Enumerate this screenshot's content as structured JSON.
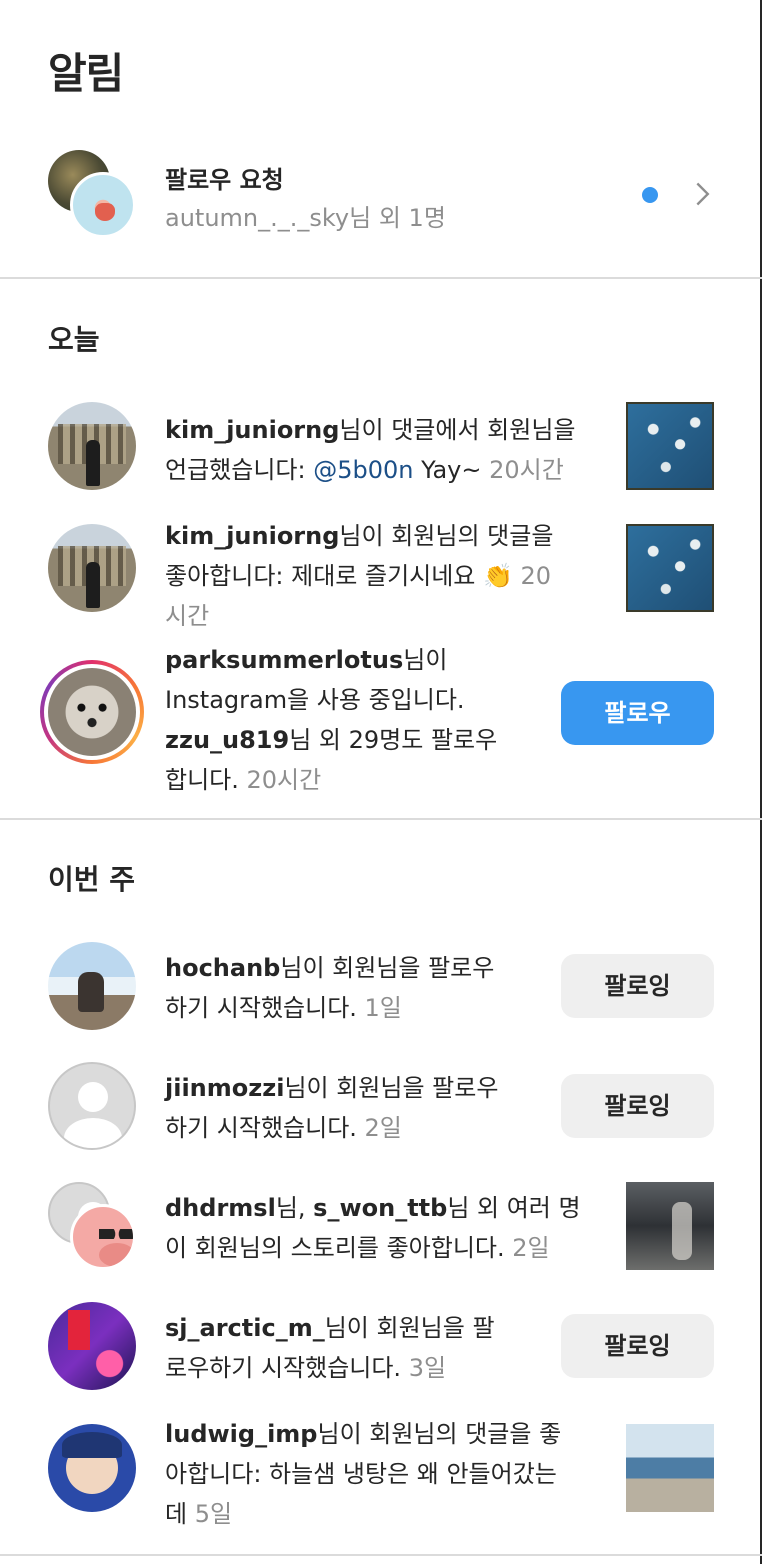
{
  "page": {
    "title": "알림"
  },
  "follow_request": {
    "title": "팔로우 요청",
    "subtitle": "autumn_._._sky님 외 1명"
  },
  "sections": {
    "today": "오늘",
    "this_week": "이번 주"
  },
  "today": [
    {
      "user": "kim_juniorng",
      "text_a": "님이 댓글에서 회원님을",
      "text_b": "언급했습니다: ",
      "mention": "@5b00n",
      "text_c": " Yay~ ",
      "time": "20시간"
    },
    {
      "user": "kim_juniorng",
      "text_a": "님이 회원님의 댓글을",
      "text_b": "좋아합니다: 제대로 즐기시네요 👏 ",
      "time_a": "20",
      "time_b": "시간"
    },
    {
      "user": "parksummerlotus",
      "text_a": "님이",
      "text_b": "Instagram을 사용 중입니다.",
      "user2": "zzu_u819",
      "text_c": "님 외 29명도 팔로우",
      "text_d": "합니다. ",
      "time": "20시간",
      "button": "팔로우"
    }
  ],
  "week": [
    {
      "user": "hochanb",
      "text_a": "님이 회원님을 팔로우",
      "text_b": "하기 시작했습니다. ",
      "time": "1일",
      "button": "팔로잉"
    },
    {
      "user": "jiinmozzi",
      "text_a": "님이 회원님을 팔로우",
      "text_b": "하기 시작했습니다. ",
      "time": "2일",
      "button": "팔로잉"
    },
    {
      "user": "dhdrmsl",
      "sep": "님, ",
      "user2": "s_won_ttb",
      "text_a": "님 외 여러 명",
      "text_b": "이 회원님의 스토리를 좋아합니다. ",
      "time": "2일"
    },
    {
      "user": "sj_arctic_m_",
      "text_a": "님이 회원님을 팔",
      "text_b": "로우하기 시작했습니다. ",
      "time": "3일",
      "button": "팔로잉"
    },
    {
      "user": "ludwig_imp",
      "text_a": "님이 회원님의 댓글을 좋",
      "text_b": "아합니다: 하늘샘 냉탕은 왜 안들어갔는",
      "text_c": "데 ",
      "time": "5일"
    }
  ]
}
